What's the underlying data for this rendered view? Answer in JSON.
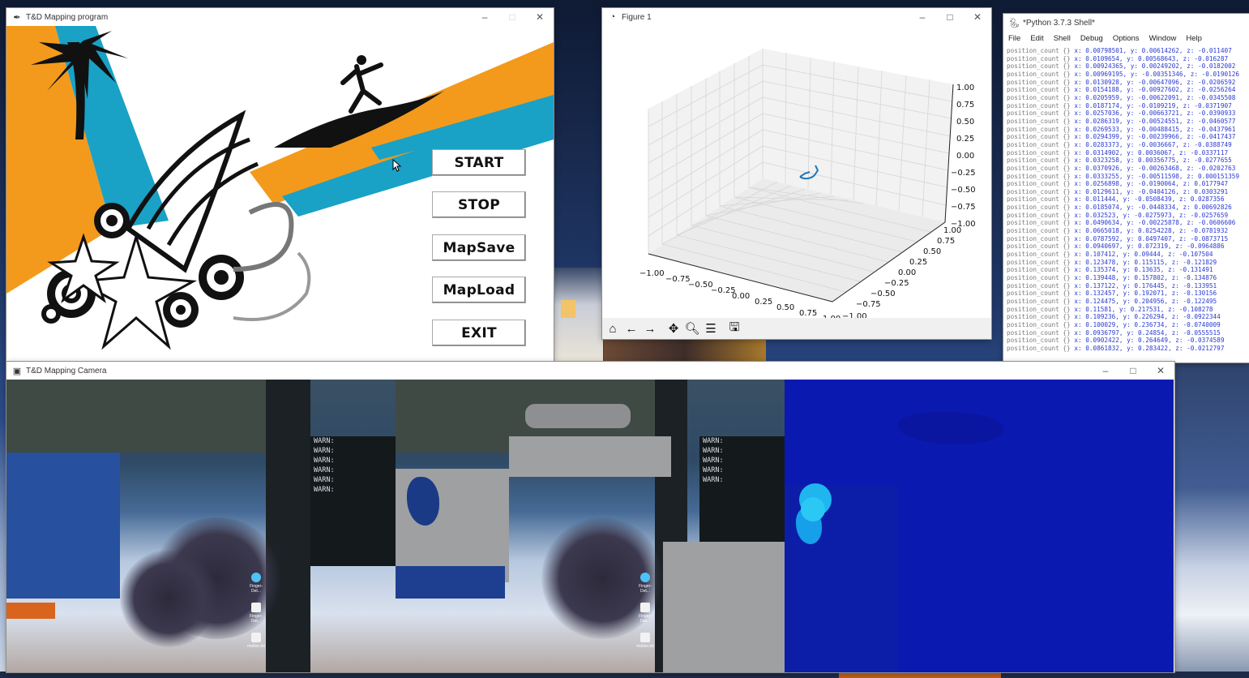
{
  "desktop": {},
  "program_window": {
    "title": "T&D Mapping program",
    "buttons": [
      "START",
      "STOP",
      "MapSave",
      "MapLoad",
      "EXIT"
    ]
  },
  "figure_window": {
    "title": "Figure 1",
    "toolbar_icons": [
      "home-icon",
      "back-arrow-icon",
      "forward-arrow-icon",
      "pan-icon",
      "zoom-icon",
      "configure-subplots-icon",
      "save-icon"
    ]
  },
  "shell_window": {
    "title": "*Python 3.7.3 Shell*",
    "menu": [
      "File",
      "Edit",
      "Shell",
      "Debug",
      "Options",
      "Window",
      "Help"
    ],
    "lines": [
      "x: 0.00798501, y: 0.00614262, z: -0.011407",
      "x: 0.0109654, y: 0.00568643, z: -0.016287",
      "x: 0.00924365, y: 0.00249202, z: -0.0182002",
      "x: 0.00969195, y: -0.00351346, z: -0.0190126",
      "x: 0.0130928, y: -0.00647096, z: -0.0206592",
      "x: 0.0154188, y: -0.00927602, z: -0.0256264",
      "x: 0.0205959, y: -0.00622091, z: -0.0345508",
      "x: 0.0187174, y: -0.0109219, z: -0.0371907",
      "x: 0.0257036, y: -0.00663721, z: -0.0390933",
      "x: 0.0286319, y: -0.00524551, z: -0.0460577",
      "x: 0.0269533, y: -0.00488415, z: -0.0437961",
      "x: 0.0294399, y: -0.00239966, z: -0.0417437",
      "x: 0.0283373, y: -0.0036667, z: -0.0388749",
      "x: 0.0314902, y: 0.0036067, z: -0.0337117",
      "x: 0.0323258, y: 0.00356775, z: -0.0277655",
      "x: 0.0370926, y: -0.00263468, z: -0.0202763",
      "x: 0.0333255, y: -0.00511598, z: 0.000151359",
      "x: 0.0256898, y: -0.0190064, z: 0.0177947",
      "x: 0.0129611, y: -0.0404126, z: 0.0303291",
      "x: 0.011444, y: -0.0508439, z: 0.0287356",
      "x: 0.0185074, y: -0.0448334, z: 0.00692826",
      "x: 0.032523, y: -0.0275973, z: -0.0257659",
      "x: 0.0490634, y: -0.00225878, z: -0.0606606",
      "x: 0.0665018, y: 0.0254228, z: -0.0781932",
      "x: 0.0787592, y: 0.0497407, z: -0.0873715",
      "x: 0.0940697, y: 0.072319, z: -0.0964886",
      "x: 0.107412, y: 0.09444, z: -0.107504",
      "x: 0.123478, y: 0.115115, z: -0.121829",
      "x: 0.135374, y: 0.13635, z: -0.131491",
      "x: 0.139448, y: 0.157802, z: -0.134876",
      "x: 0.137122, y: 0.176445, z: -0.133951",
      "x: 0.132457, y: 0.192071, z: -0.130156",
      "x: 0.124475, y: 0.204956, z: -0.122495",
      "x: 0.11581, y: 0.217531, z: -0.108278",
      "x: 0.109236, y: 0.226294, z: -0.0922344",
      "x: 0.100029, y: 0.236734, z: -0.0740009",
      "x: 0.0936797, y: 0.24854, z: -0.0555515",
      "x: 0.0902422, y: 0.264649, z: -0.0374589",
      "x: 0.0861832, y: 0.283422, z: -0.0212797"
    ]
  },
  "camera_window": {
    "title": "T&D Mapping Camera",
    "terminal_lines": [
      "WARN:",
      "WARN:",
      "WARN:",
      "WARN:",
      "WARN:",
      "WARN:",
      "WARN:",
      "WARN:",
      "WARN:",
      "WARN:",
      "WARN:"
    ],
    "desktop_icons": [
      "Finger-Det...",
      "Finger-Det...",
      "motion.txt"
    ]
  }
}
